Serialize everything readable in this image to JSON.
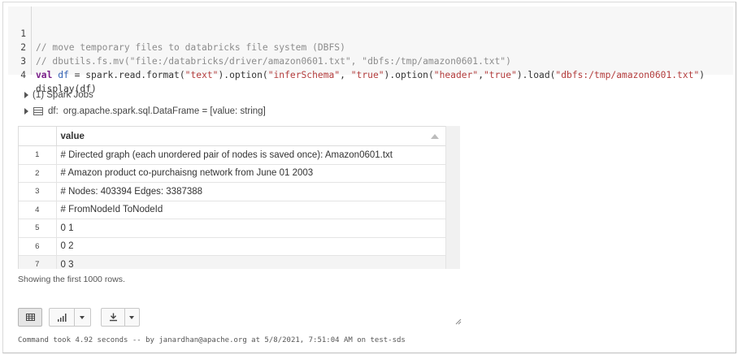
{
  "code": {
    "lines": [
      {
        "number": "1",
        "text": "// move temporary files to databricks file system (DBFS)"
      },
      {
        "number": "2",
        "text": "// dbutils.fs.mv(\"file:/databricks/driver/amazon0601.txt\", \"dbfs:/tmp/amazon0601.txt\")"
      },
      {
        "number": "3",
        "kw": "val",
        "var": "df",
        "eq": " = ",
        "p1": "spark.read.format(",
        "s1": "\"text\"",
        "p2": ").option(",
        "s2": "\"inferSchema\"",
        "p3": ", ",
        "s3": "\"true\"",
        "p4": ").option(",
        "s4": "\"header\"",
        "p5": ",",
        "s5": "\"true\"",
        "p6": ").load(",
        "s6": "\"dbfs:/tmp/amazon0601.txt\"",
        "p7": ")"
      },
      {
        "number": "4",
        "text": "display(df)"
      }
    ]
  },
  "output": {
    "spark_jobs_label": "(1) Spark Jobs",
    "df_name": "df:",
    "df_type": "org.apache.spark.sql.DataFrame = [value: string]"
  },
  "table": {
    "column_header": "value",
    "rows": [
      {
        "index": "1",
        "value": "# Directed graph (each unordered pair of nodes is saved once): Amazon0601.txt"
      },
      {
        "index": "2",
        "value": "# Amazon product co-purchaisng network from June 01 2003"
      },
      {
        "index": "3",
        "value": "# Nodes: 403394 Edges: 3387388"
      },
      {
        "index": "4",
        "value": "# FromNodeId ToNodeId"
      },
      {
        "index": "5",
        "value": "0 1"
      },
      {
        "index": "6",
        "value": "0 2"
      },
      {
        "index": "7",
        "value": "0 3"
      }
    ]
  },
  "showing_text": "Showing the first 1000 rows.",
  "icons": {
    "table_view": "table-icon",
    "chart_view": "bar-chart-icon",
    "download": "download-icon"
  },
  "status_text": "Command took 4.92 seconds -- by janardhan@apache.org at 5/8/2021, 7:51:04 AM on test-sds"
}
